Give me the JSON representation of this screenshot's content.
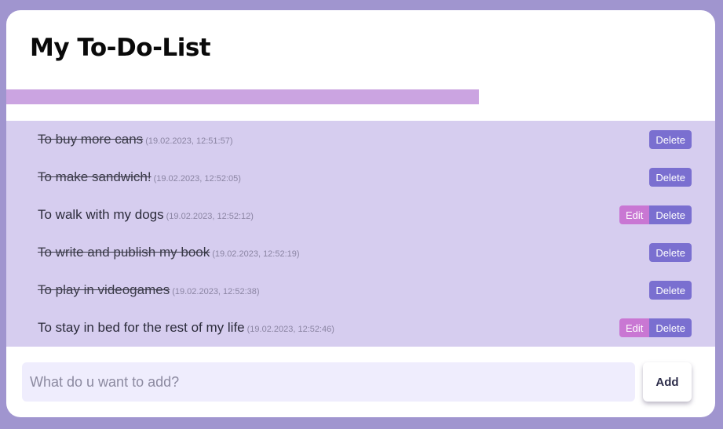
{
  "header": {
    "title": "My To-Do-List"
  },
  "progress": {
    "completed_fraction": 0.667
  },
  "todos": [
    {
      "text": "To buy more cans",
      "time": "(19.02.2023, 12:51:57)",
      "done": true,
      "delete_label": "Delete"
    },
    {
      "text": "To make sandwich!",
      "time": "(19.02.2023, 12:52:05)",
      "done": true,
      "delete_label": "Delete"
    },
    {
      "text": "To walk with my dogs",
      "time": "(19.02.2023, 12:52:12)",
      "done": false,
      "edit_label": "Edit",
      "delete_label": "Delete"
    },
    {
      "text": "To write and publish my book",
      "time": "(19.02.2023, 12:52:19)",
      "done": true,
      "delete_label": "Delete"
    },
    {
      "text": "To play in videogames",
      "time": "(19.02.2023, 12:52:38)",
      "done": true,
      "delete_label": "Delete"
    },
    {
      "text": "To stay in bed for the rest of my life",
      "time": "(19.02.2023, 12:52:46)",
      "done": false,
      "edit_label": "Edit",
      "delete_label": "Delete"
    }
  ],
  "form": {
    "placeholder": "What do u want to add?",
    "value": "",
    "add_label": "Add"
  },
  "colors": {
    "background": "#a095cf",
    "progress": "#cba4e1",
    "list_bg": "#d6cdef",
    "edit": "#c977d3",
    "delete": "#7a6fd0",
    "input_bg": "#efedfd"
  }
}
